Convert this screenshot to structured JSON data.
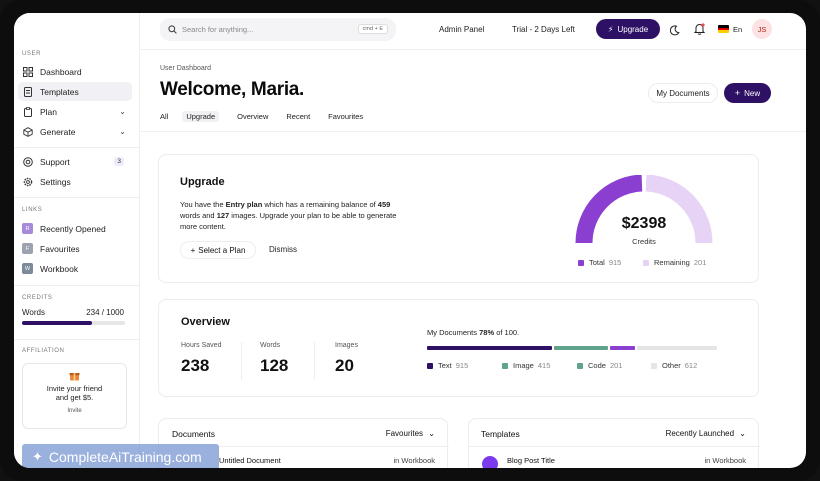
{
  "sidebar": {
    "section_user": "USER",
    "items": [
      {
        "label": "Dashboard",
        "icon": "grid-icon"
      },
      {
        "label": "Templates",
        "icon": "document-icon"
      },
      {
        "label": "Plan",
        "icon": "clipboard-icon"
      },
      {
        "label": "Generate",
        "icon": "cube-icon"
      }
    ],
    "support_label": "Support",
    "support_badge": "3",
    "settings_label": "Settings",
    "section_links": "LINKS",
    "links": [
      {
        "letter": "R",
        "label": "Recently Opened",
        "color": "#a78bda"
      },
      {
        "letter": "F",
        "label": "Favourites",
        "color": "#9ca3af"
      },
      {
        "letter": "W",
        "label": "Workbook",
        "color": "#7c8a99"
      }
    ],
    "section_credits": "CREDITS",
    "credits_label": "Words",
    "credits_value": "234 / 1000",
    "credits_fraction": 0.68,
    "section_affiliation": "AFFILIATION",
    "invite_line1": "Invite your friend",
    "invite_line2": "and get $5.",
    "invite_button": "Invite"
  },
  "topbar": {
    "search_placeholder": "Search for anything...",
    "search_shortcut": "cmd + E",
    "admin_panel": "Admin Panel",
    "trial": "Trial - 2 Days Left",
    "upgrade": "Upgrade",
    "language": "En",
    "avatar_initials": "JS"
  },
  "header": {
    "breadcrumb": "User Dashboard",
    "title": "Welcome, Maria.",
    "tabs": [
      "All",
      "Upgrade",
      "Overview",
      "Recent",
      "Favourites"
    ],
    "my_documents": "My Documents",
    "new_button": "New"
  },
  "upgrade_card": {
    "title": "Upgrade",
    "text_1": "You have the ",
    "plan": "Entry plan",
    "text_2": " which has a remaining balance of ",
    "words": "459",
    "text_3": " words and ",
    "images": "127",
    "text_4": " images. Upgrade your plan to be able to generate more content.",
    "select_plan": "Select a Plan",
    "dismiss": "Dismiss",
    "gauge_value": "$2398",
    "gauge_label": "Credits",
    "total_label": "Total",
    "total_value": "915",
    "remaining_label": "Remaining",
    "remaining_value": "201",
    "total_color": "#8b3fd0",
    "remaining_color": "#e6d3f5"
  },
  "overview_card": {
    "title": "Overview",
    "stats": [
      {
        "label": "Hours Saved",
        "value": "238"
      },
      {
        "label": "Words",
        "value": "128"
      },
      {
        "label": "Images",
        "value": "20"
      }
    ],
    "docs_prefix": "My Documents ",
    "docs_percent": "78%",
    "docs_suffix": " of 100.",
    "segments": [
      {
        "label": "Text",
        "value": "915",
        "color": "#2e1065",
        "fraction": 0.44
      },
      {
        "label": "Image",
        "value": "415",
        "color": "#5fa38a",
        "fraction": 0.19
      },
      {
        "label": "Code",
        "value": "201",
        "color": "#8b3fd0",
        "fraction": 0.09
      },
      {
        "label": "Other",
        "value": "612",
        "color": "#e5e5e5",
        "fraction": 0.28
      }
    ]
  },
  "documents_card": {
    "title": "Documents",
    "filter": "Favourites",
    "row_title": "Untitled Document",
    "row_location": "in Workbook"
  },
  "templates_card": {
    "title": "Templates",
    "filter": "Recently Launched",
    "row_title": "Blog Post Title",
    "row_location": "in Workbook"
  },
  "watermark": "CompleteAiTraining.com"
}
